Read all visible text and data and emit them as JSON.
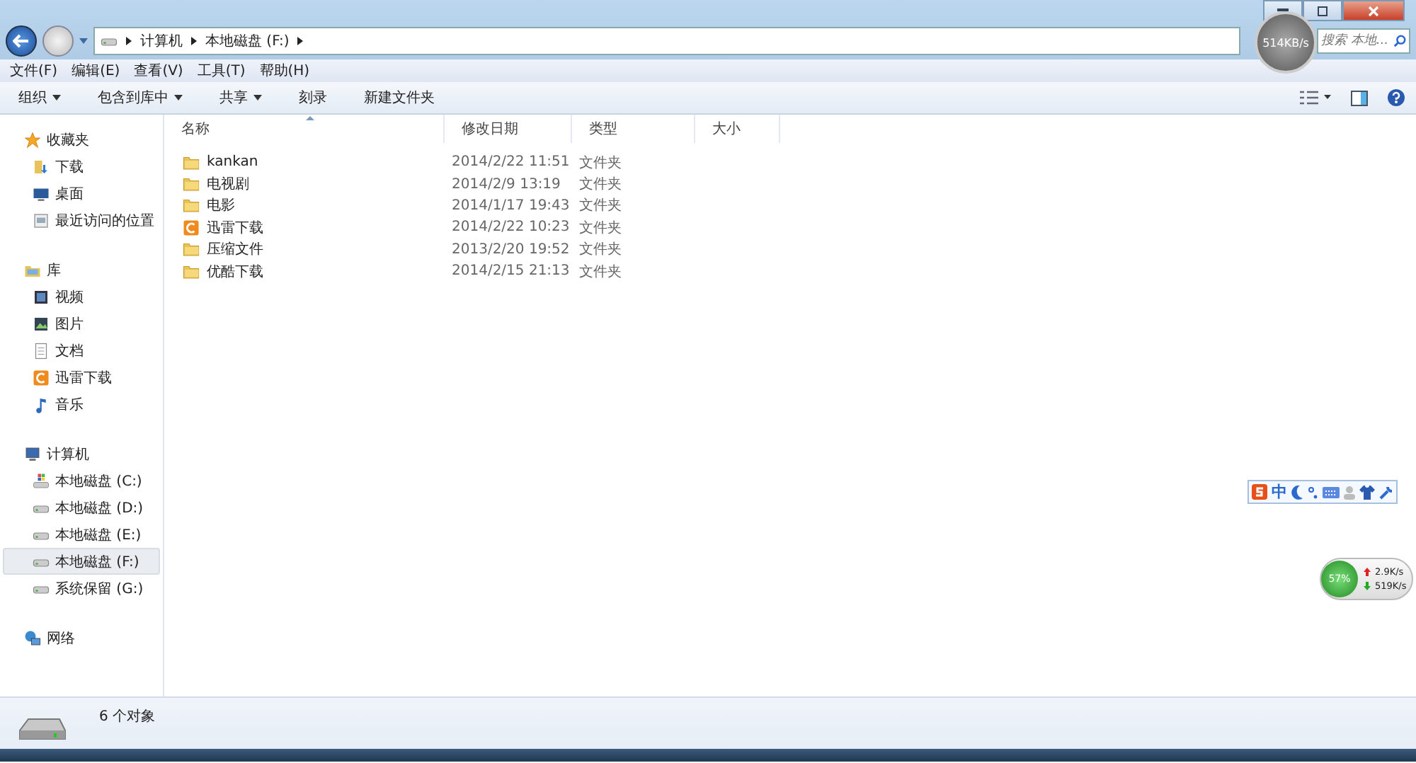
{
  "address": {
    "crumbs": [
      "计算机",
      "本地磁盘 (F:)"
    ]
  },
  "search": {
    "placeholder": "搜索 本地..."
  },
  "menu": [
    "文件(F)",
    "编辑(E)",
    "查看(V)",
    "工具(T)",
    "帮助(H)"
  ],
  "toolbar": [
    {
      "label": "组织",
      "dropdown": true
    },
    {
      "label": "包含到库中",
      "dropdown": true
    },
    {
      "label": "共享",
      "dropdown": true
    },
    {
      "label": "刻录",
      "dropdown": false
    },
    {
      "label": "新建文件夹",
      "dropdown": false
    }
  ],
  "sidebar": [
    {
      "label": "收藏夹",
      "kind": "star",
      "items": [
        {
          "label": "下载",
          "kind": "download",
          "selected": false
        },
        {
          "label": "桌面",
          "kind": "desktop",
          "selected": false
        },
        {
          "label": "最近访问的位置",
          "kind": "recent",
          "selected": false
        }
      ]
    },
    {
      "label": "库",
      "kind": "library",
      "items": [
        {
          "label": "视频",
          "kind": "video",
          "selected": false
        },
        {
          "label": "图片",
          "kind": "picture",
          "selected": false
        },
        {
          "label": "文档",
          "kind": "document",
          "selected": false
        },
        {
          "label": "迅雷下载",
          "kind": "app",
          "selected": false
        },
        {
          "label": "音乐",
          "kind": "music",
          "selected": false
        }
      ]
    },
    {
      "label": "计算机",
      "kind": "computer",
      "items": [
        {
          "label": "本地磁盘 (C:)",
          "kind": "sysdrive",
          "selected": false
        },
        {
          "label": "本地磁盘 (D:)",
          "kind": "drive",
          "selected": false
        },
        {
          "label": "本地磁盘 (E:)",
          "kind": "drive",
          "selected": false
        },
        {
          "label": "本地磁盘 (F:)",
          "kind": "drive",
          "selected": true
        },
        {
          "label": "系统保留 (G:)",
          "kind": "drive",
          "selected": false
        }
      ]
    },
    {
      "label": "网络",
      "kind": "network"
    }
  ],
  "table": {
    "columns": [
      "名称",
      "修改日期",
      "类型",
      "大小"
    ],
    "rows": [
      {
        "name": "kankan",
        "modified": "2014/2/22 11:51",
        "type": "文件夹",
        "kind": "folder"
      },
      {
        "name": "电视剧",
        "modified": "2014/2/9 13:19",
        "type": "文件夹",
        "kind": "folder"
      },
      {
        "name": "电影",
        "modified": "2014/1/17 19:43",
        "type": "文件夹",
        "kind": "folder"
      },
      {
        "name": "迅雷下载",
        "modified": "2014/2/22 10:23",
        "type": "文件夹",
        "kind": "app"
      },
      {
        "name": "压缩文件",
        "modified": "2013/2/20 19:52",
        "type": "文件夹",
        "kind": "folder"
      },
      {
        "name": "优酷下载",
        "modified": "2014/2/15 21:13",
        "type": "文件夹",
        "kind": "folder"
      }
    ]
  },
  "status_bar": {
    "text": "6 个对象"
  },
  "speed_bubble": {
    "text": "514KB/s"
  },
  "ime_toolbar": {
    "mode": "中"
  },
  "net_meter": {
    "percent": "57%",
    "upload": "2.9K/s",
    "download": "519K/s"
  }
}
